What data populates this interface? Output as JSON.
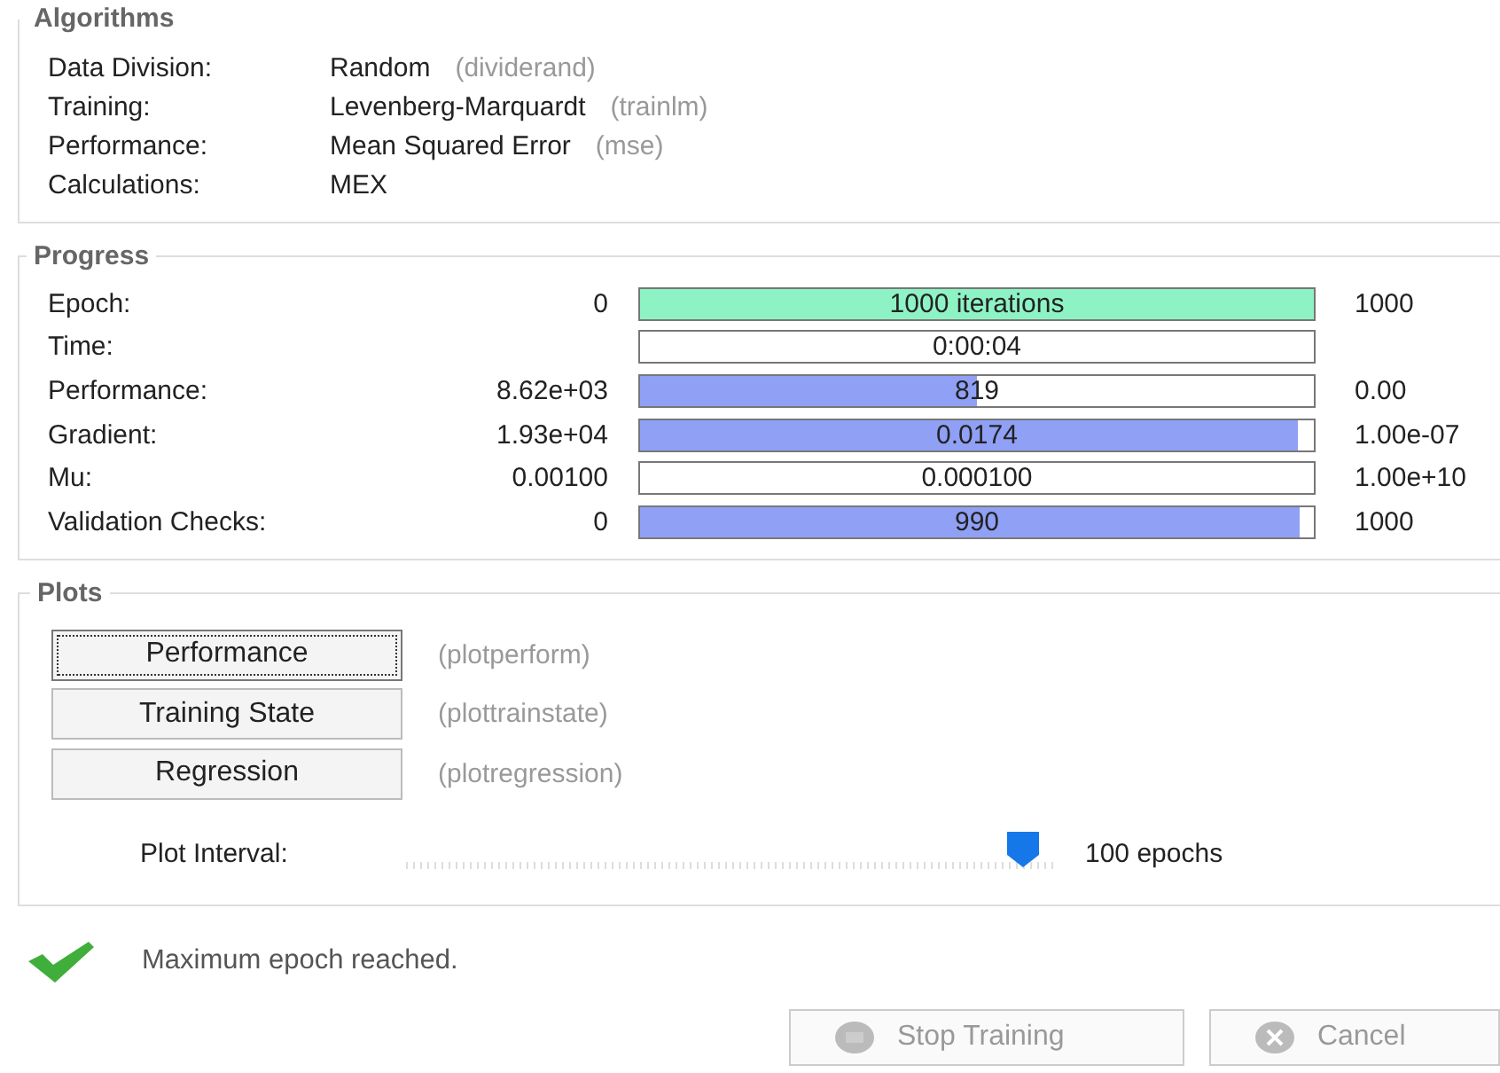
{
  "algorithms": {
    "title": "Algorithms",
    "rows": [
      {
        "label": "Data Division:",
        "value": "Random",
        "function": "(dividerand)"
      },
      {
        "label": "Training:",
        "value": "Levenberg-Marquardt",
        "function": "(trainlm)"
      },
      {
        "label": "Performance:",
        "value": "Mean Squared Error",
        "function": "(mse)"
      },
      {
        "label": "Calculations:",
        "value": "MEX"
      }
    ]
  },
  "progress": {
    "title": "Progress",
    "rows": [
      {
        "label": "Epoch:",
        "start": "0",
        "bar_text": "1000 iterations",
        "level": 1,
        "color": "#8ef3c4",
        "end": "1000"
      },
      {
        "label": "Time:",
        "bar_text": "0:00:04"
      },
      {
        "label": "Performance:",
        "start": "8.62e+03",
        "bar_text": "819",
        "level": 0.5,
        "color": "#8fa0f5",
        "end": "0.00"
      },
      {
        "label": "Gradient:",
        "start": "1.93e+04",
        "bar_text": "0.0174",
        "level": 0.975,
        "color": "#8fa0f5",
        "end": "1.00e-07"
      },
      {
        "label": "Mu:",
        "start": "0.00100",
        "bar_text": "0.000100",
        "end": "1.00e+10"
      },
      {
        "label": "Validation Checks:",
        "start": "0",
        "bar_text": "990",
        "level": 0.98,
        "color": "#8fa0f5",
        "end": "1000"
      }
    ]
  },
  "plots": {
    "title": "Plots",
    "buttons": [
      {
        "label": "Performance",
        "function": "(plotperform)",
        "focused": true
      },
      {
        "label": "Training State",
        "function": "(plottrainstate)",
        "focused": false
      },
      {
        "label": "Regression",
        "function": "(plotregression)",
        "focused": false
      }
    ],
    "interval": {
      "label": "Plot Interval:",
      "level": 0.98,
      "reading": "100 epochs"
    }
  },
  "status": {
    "message": "Maximum epoch reached."
  },
  "actions": [
    {
      "label": "Stop Training",
      "disabled": true,
      "kind": "stop"
    },
    {
      "label": "Cancel",
      "disabled": true,
      "kind": "cancel"
    }
  ]
}
